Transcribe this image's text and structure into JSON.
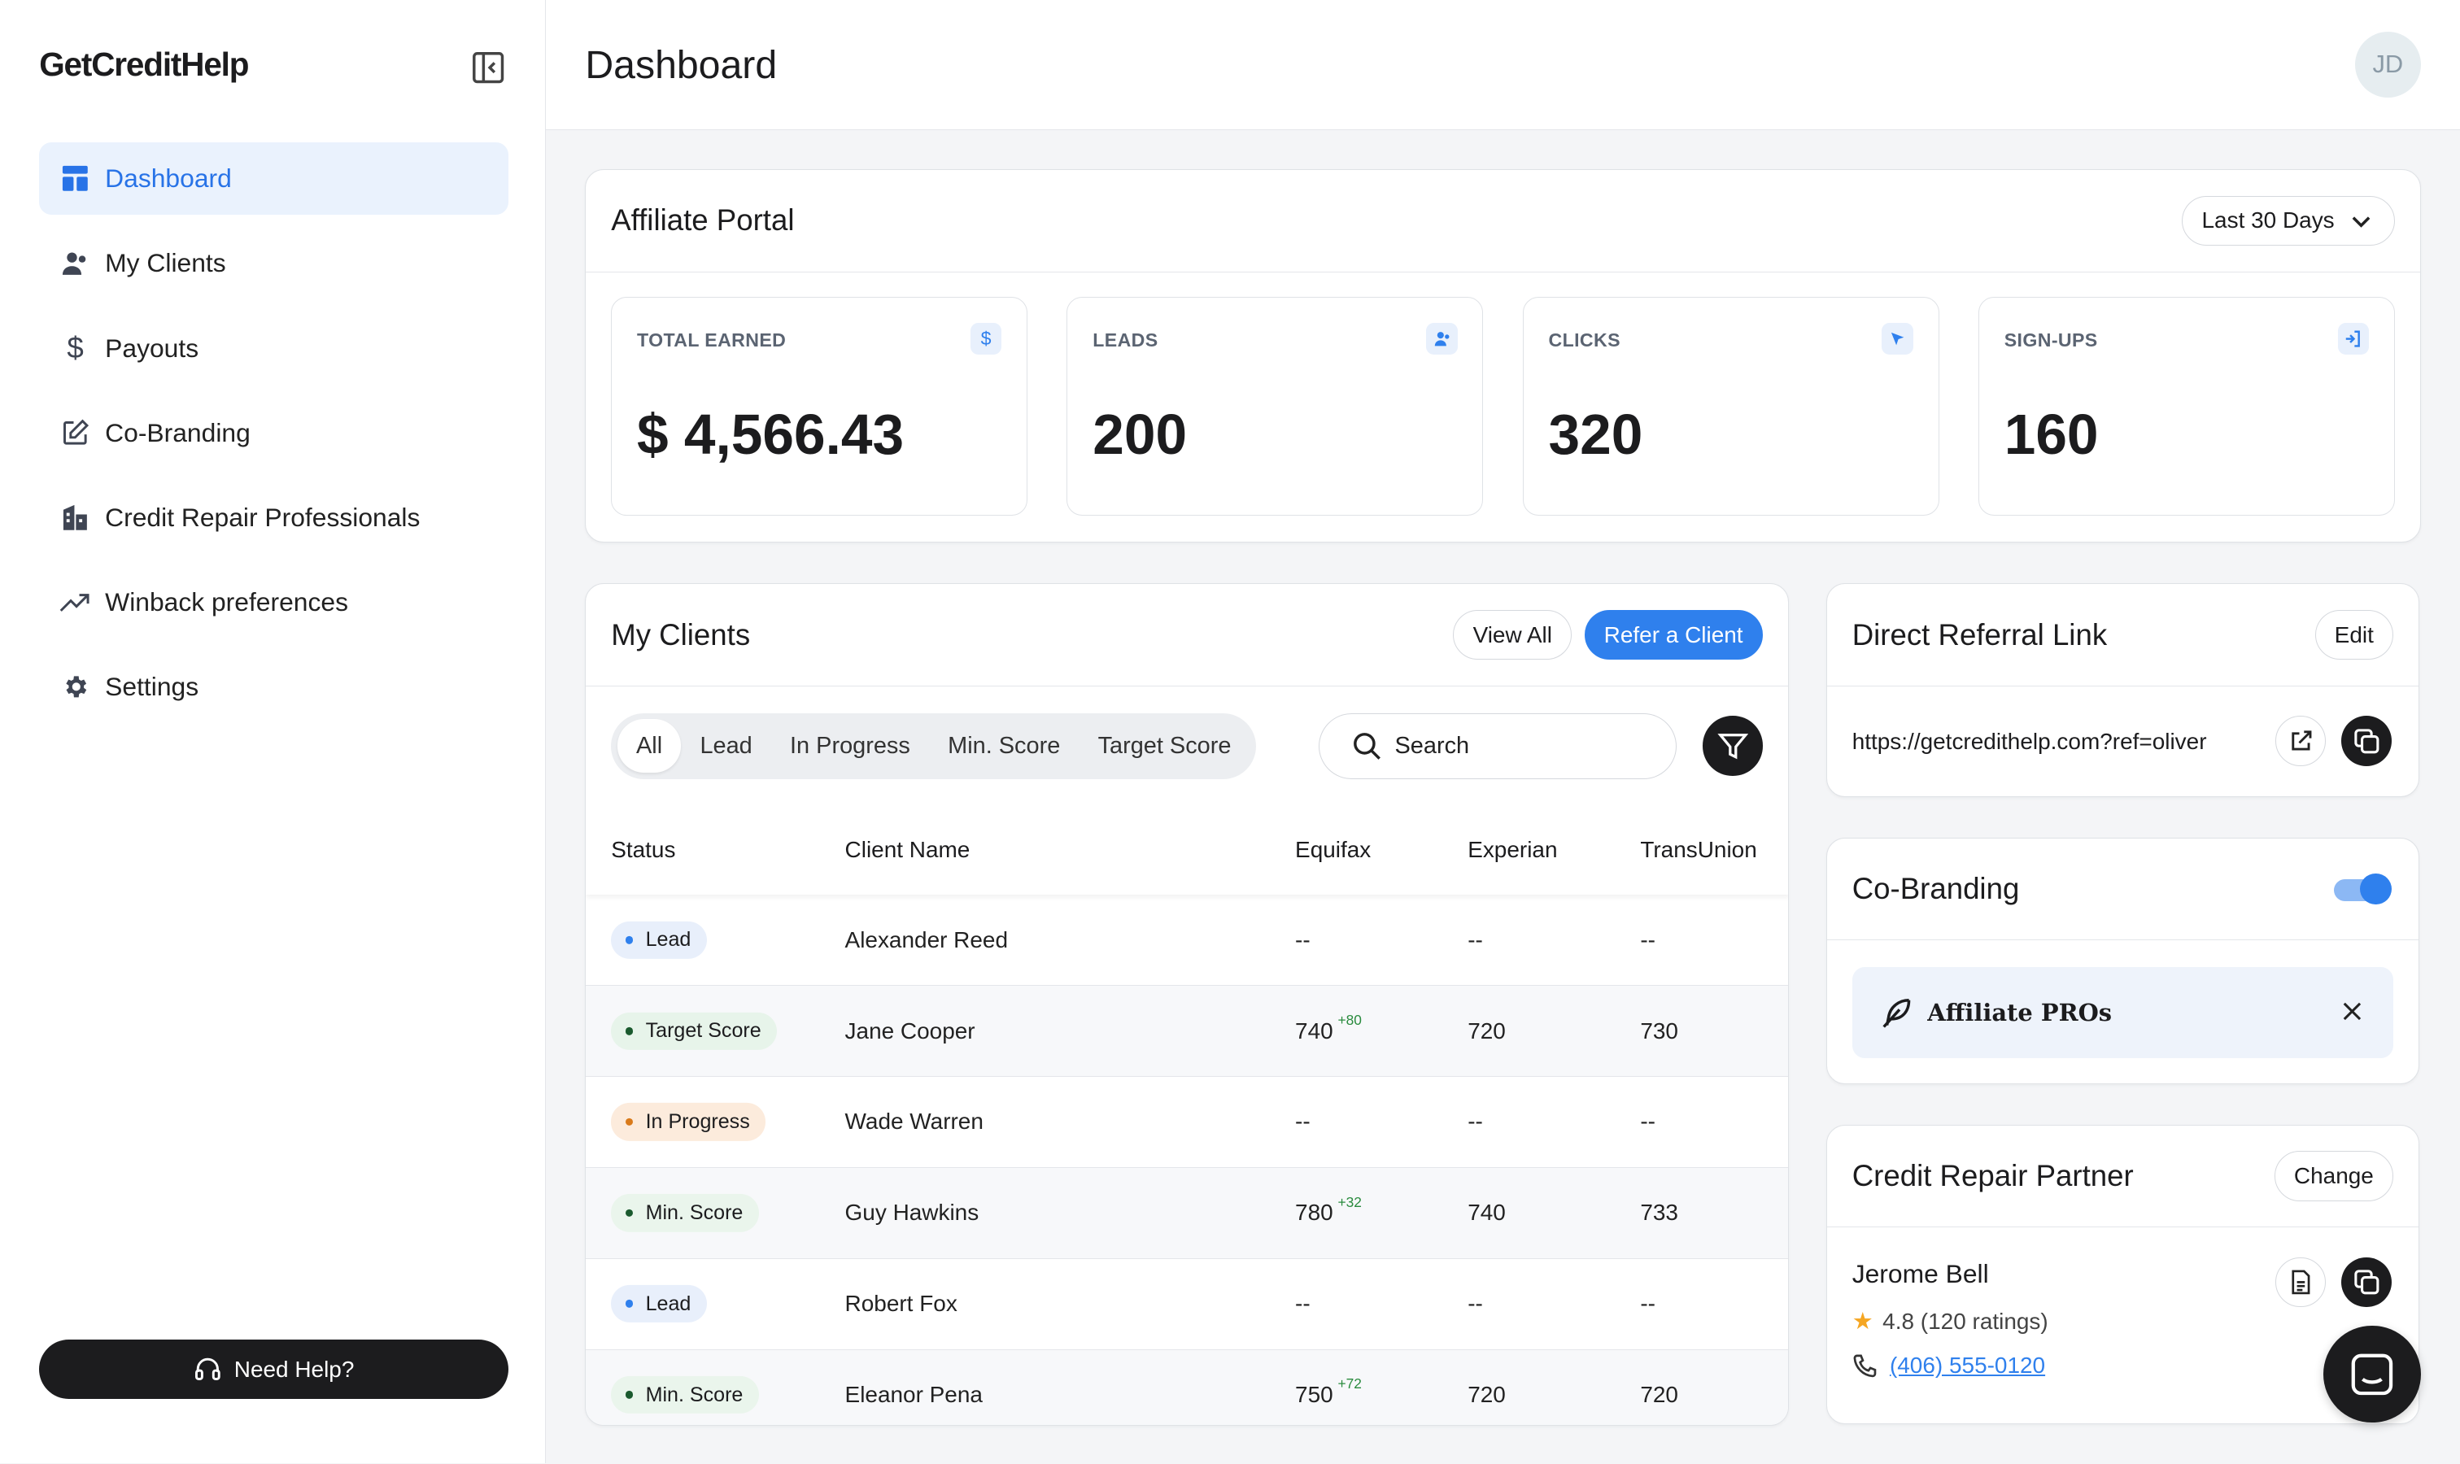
{
  "brand": {
    "logo_text": "GetCreditHelp"
  },
  "sidebar": {
    "items": [
      {
        "label": "Dashboard",
        "icon": "dashboard-icon",
        "active": true
      },
      {
        "label": "My Clients",
        "icon": "users-icon"
      },
      {
        "label": "Payouts",
        "icon": "dollar-icon"
      },
      {
        "label": "Co-Branding",
        "icon": "edit-icon"
      },
      {
        "label": "Credit Repair Professionals",
        "icon": "building-icon"
      },
      {
        "label": "Winback preferences",
        "icon": "trending-up-icon"
      },
      {
        "label": "Settings",
        "icon": "gear-icon"
      }
    ],
    "help_label": "Need Help?"
  },
  "header": {
    "title": "Dashboard",
    "avatar_initials": "JD"
  },
  "portal": {
    "title": "Affiliate Portal",
    "range_label": "Last 30 Days",
    "stats": [
      {
        "label": "TOTAL EARNED",
        "value": "$ 4,566.43",
        "icon": "dollar-icon"
      },
      {
        "label": "LEADS",
        "value": "200",
        "icon": "user-icon"
      },
      {
        "label": "CLICKS",
        "value": "320",
        "icon": "cursor-icon"
      },
      {
        "label": "SIGN-UPS",
        "value": "160",
        "icon": "sign-in-icon"
      }
    ]
  },
  "clients": {
    "title": "My Clients",
    "view_all_label": "View All",
    "refer_label": "Refer a Client",
    "filters": [
      "All",
      "Lead",
      "In Progress",
      "Min. Score",
      "Target Score"
    ],
    "active_filter": "All",
    "search_placeholder": "Search",
    "columns": [
      "Status",
      "Client Name",
      "Equifax",
      "Experian",
      "TransUnion"
    ],
    "rows": [
      {
        "status": "Lead",
        "name": "Alexander Reed",
        "equifax": "--",
        "equifax_delta": "",
        "experian": "--",
        "transunion": "--"
      },
      {
        "status": "Target Score",
        "name": "Jane Cooper",
        "equifax": "740",
        "equifax_delta": "+80",
        "experian": "720",
        "transunion": "730"
      },
      {
        "status": "In Progress",
        "name": "Wade Warren",
        "equifax": "--",
        "equifax_delta": "",
        "experian": "--",
        "transunion": "--"
      },
      {
        "status": "Min. Score",
        "name": "Guy Hawkins",
        "equifax": "780",
        "equifax_delta": "+32",
        "experian": "740",
        "transunion": "733"
      },
      {
        "status": "Lead",
        "name": "Robert Fox",
        "equifax": "--",
        "equifax_delta": "",
        "experian": "--",
        "transunion": "--"
      },
      {
        "status": "Min. Score",
        "name": "Eleanor Pena",
        "equifax": "750",
        "equifax_delta": "+72",
        "experian": "720",
        "transunion": "720"
      }
    ]
  },
  "referral": {
    "title": "Direct Referral Link",
    "edit_label": "Edit",
    "url": "https://getcredithelp.com?ref=oliver"
  },
  "cobranding": {
    "title": "Co-Branding",
    "enabled": true,
    "brand_name": "Affiliate PROs"
  },
  "partner": {
    "title": "Credit Repair Partner",
    "change_label": "Change",
    "name": "Jerome Bell",
    "rating": "4.8 (120 ratings)",
    "phone": "(406) 555-0120"
  },
  "colors": {
    "accent": "#2f80ed",
    "dark": "#1c1c1e",
    "active_nav_bg": "#eaf2fd"
  }
}
